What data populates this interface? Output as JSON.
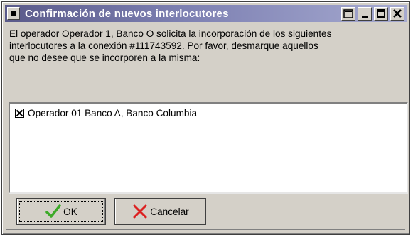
{
  "window": {
    "title": "Confirmación de nuevos interlocutores"
  },
  "message": {
    "line1": "El operador Operador 1, Banco O solicita la incorporación de los siguientes",
    "line2": "interlocutores a la conexión #111743592. Por favor, desmarque aquellos",
    "line3": "que no desee que se incorporen a la misma:"
  },
  "list": {
    "items": [
      {
        "label": "Operador 01 Banco A, Banco Columbia",
        "checked": true
      }
    ]
  },
  "buttons": {
    "ok_label": "OK",
    "cancel_label": "Cancelar"
  },
  "icons": {
    "ok": "checkmark-icon",
    "cancel": "x-icon",
    "system_menu": "system-menu-icon",
    "help": "help-icon",
    "minimize": "minimize-icon",
    "maximize": "maximize-icon",
    "close": "close-icon"
  },
  "colors": {
    "title_gradient_start": "#5a5a8a",
    "title_gradient_end": "#a6aad0",
    "face": "#d4d0c8",
    "ok_icon": "#3caa28",
    "cancel_icon": "#dc2020"
  }
}
